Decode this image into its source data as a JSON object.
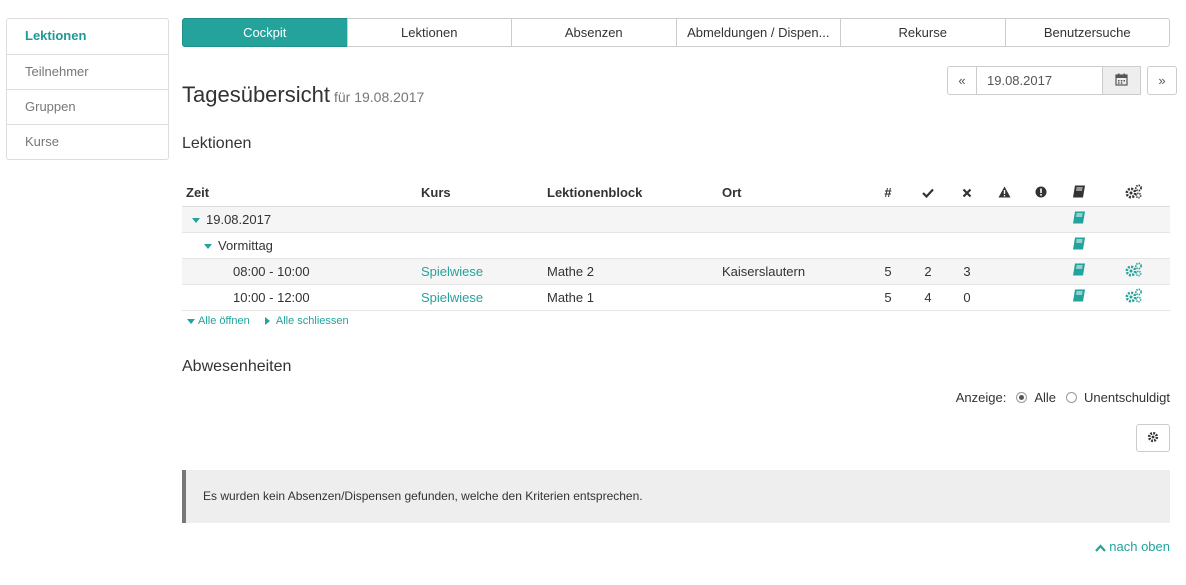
{
  "sidebar": {
    "items": [
      {
        "label": "Lektionen",
        "active": true
      },
      {
        "label": "Teilnehmer"
      },
      {
        "label": "Gruppen"
      },
      {
        "label": "Kurse"
      }
    ]
  },
  "tabs": [
    {
      "label": "Cockpit",
      "active": true
    },
    {
      "label": "Lektionen"
    },
    {
      "label": "Absenzen"
    },
    {
      "label": "Abmeldungen / Dispen..."
    },
    {
      "label": "Rekurse"
    },
    {
      "label": "Benutzersuche"
    }
  ],
  "datenav": {
    "prev": "«",
    "date": "19.08.2017",
    "next": "»",
    "calendar_icon": "calendar-icon"
  },
  "page": {
    "title": "Tagesübersicht",
    "subtitle": "für 19.08.2017"
  },
  "lektionen": {
    "heading": "Lektionen",
    "columns": {
      "zeit": "Zeit",
      "kurs": "Kurs",
      "block": "Lektionenblock",
      "ort": "Ort",
      "count": "#"
    },
    "group_date": "19.08.2017",
    "group_part": "Vormittag",
    "rows": [
      {
        "zeit": "08:00 - 10:00",
        "kurs": "Spielwiese",
        "block": "Mathe 2",
        "ort": "Kaiserslautern",
        "count": "5",
        "present": "2",
        "absent": "3"
      },
      {
        "zeit": "10:00 - 12:00",
        "kurs": "Spielwiese",
        "block": "Mathe 1",
        "ort": "",
        "count": "5",
        "present": "4",
        "absent": "0"
      }
    ],
    "open_all": "Alle öffnen",
    "close_all": "Alle schliessen"
  },
  "abwesenheiten": {
    "heading": "Abwesenheiten",
    "filter_label": "Anzeige:",
    "option_all": "Alle",
    "option_unexcused": "Unentschuldigt",
    "empty_message": "Es wurden kein Absenzen/Dispensen gefunden, welche den Kriterien entsprechen."
  },
  "footer": {
    "top_link": "nach oben"
  },
  "colors": {
    "accent": "#23a39c"
  }
}
